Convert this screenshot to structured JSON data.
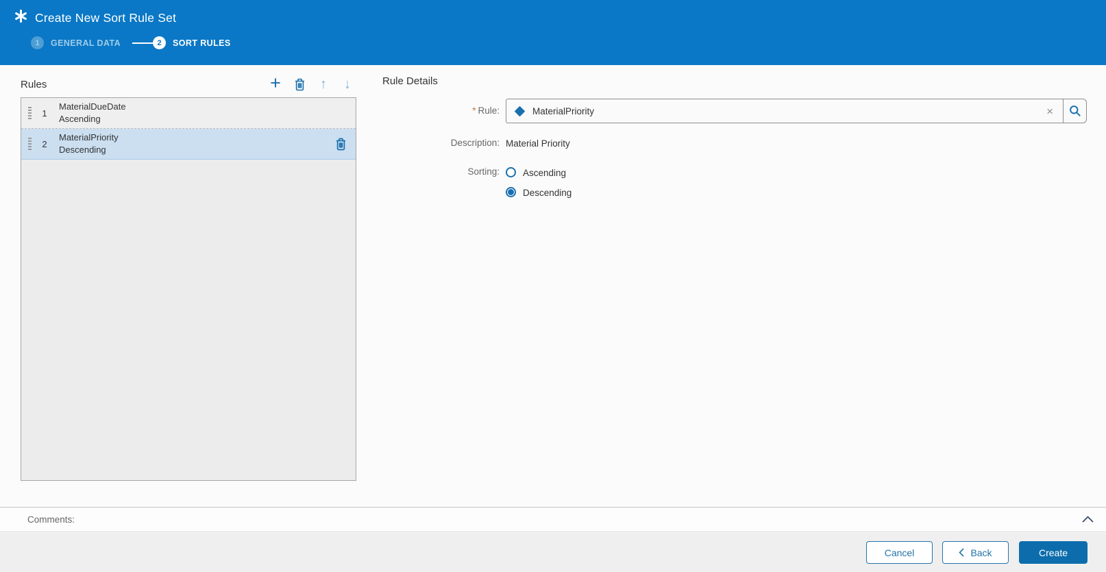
{
  "header": {
    "title": "Create New Sort Rule Set",
    "steps": [
      {
        "number": "1",
        "label": "GENERAL DATA",
        "state": "visited"
      },
      {
        "number": "2",
        "label": "SORT RULES",
        "state": "active"
      }
    ]
  },
  "rules_panel": {
    "title": "Rules",
    "rows": [
      {
        "index": "1",
        "name": "MaterialDueDate",
        "direction": "Ascending",
        "selected": false
      },
      {
        "index": "2",
        "name": "MaterialPriority",
        "direction": "Descending",
        "selected": true
      }
    ]
  },
  "rule_details": {
    "title": "Rule Details",
    "rule_required_marker": "*",
    "rule_label": "Rule:",
    "rule_value": "MaterialPriority",
    "description_label": "Description:",
    "description_value": "Material Priority",
    "sorting_label": "Sorting:",
    "options": [
      {
        "label": "Ascending",
        "selected": false
      },
      {
        "label": "Descending",
        "selected": true
      }
    ]
  },
  "comments": {
    "label": "Comments:"
  },
  "footer": {
    "cancel": "Cancel",
    "back": "Back",
    "create": "Create"
  },
  "icons": {
    "add": "+",
    "move_up": "↑",
    "move_down": "↓",
    "clear": "×"
  },
  "colors": {
    "header_blue": "#0a78c6",
    "accent_blue": "#1a6fad",
    "primary_button_blue": "#0d6dac",
    "selected_row_blue": "#cbdff1",
    "required_asterisk_orange": "#c4762e"
  }
}
